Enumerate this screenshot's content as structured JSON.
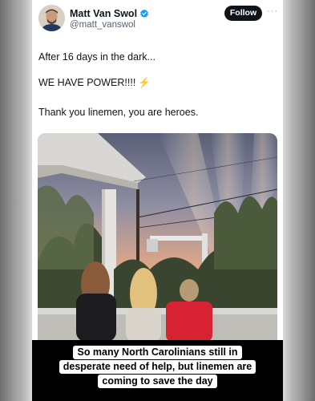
{
  "author": {
    "display_name": "Matt Van Swol",
    "handle": "@matt_vanswol",
    "follow_label": "Follow",
    "more_label": "···",
    "verified": true,
    "verified_color": "#1d9bf0"
  },
  "tweet": {
    "lines": [
      "After 16 days in the dark...",
      "WE HAVE POWER!!!!",
      "Thank you linemen, you are heroes."
    ],
    "emoji": "⚡"
  },
  "photo": {
    "icon": "sunset-photo",
    "subjects": [
      "girl-dark-hair",
      "girl-blonde",
      "boy-red-shirt"
    ]
  },
  "caption": {
    "lines": [
      "So many North Carolinians still in",
      "desperate need of help, but linemen are",
      "coming to save the day"
    ]
  }
}
